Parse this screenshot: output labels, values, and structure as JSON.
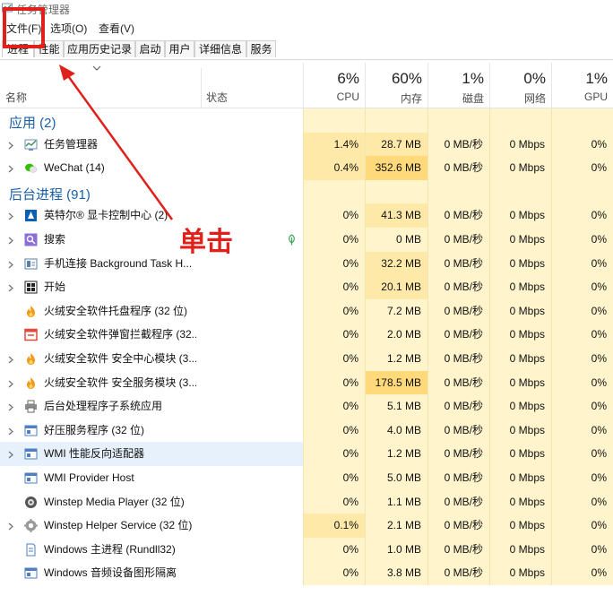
{
  "window": {
    "title": "任务管理器"
  },
  "menu": {
    "items": [
      "文件(F)",
      "选项(O)",
      "查看(V)"
    ]
  },
  "tabs": [
    "进程",
    "性能",
    "应用历史记录",
    "启动",
    "用户",
    "详细信息",
    "服务"
  ],
  "active_tab": 0,
  "header": {
    "name_label": "名称",
    "status_label": "状态",
    "columns": [
      {
        "pct": "6%",
        "label": "CPU"
      },
      {
        "pct": "60%",
        "label": "内存"
      },
      {
        "pct": "1%",
        "label": "磁盘"
      },
      {
        "pct": "0%",
        "label": "网络"
      },
      {
        "pct": "1%",
        "label": "GPU"
      }
    ]
  },
  "groups": {
    "apps": "应用 (2)",
    "background": "后台进程 (91)"
  },
  "apps": [
    {
      "name": "任务管理器",
      "icon": "task-manager-icon",
      "expandable": true,
      "cpu": "1.4%",
      "mem": "28.7 MB",
      "disk": "0 MB/秒",
      "net": "0 Mbps",
      "gpu": "0%"
    },
    {
      "name": "WeChat (14)",
      "icon": "wechat-icon",
      "expandable": true,
      "cpu": "0.4%",
      "mem": "352.6 MB",
      "disk": "0 MB/秒",
      "net": "0 Mbps",
      "gpu": "0%"
    }
  ],
  "background": [
    {
      "name": "英特尔® 显卡控制中心 (2)",
      "icon": "intel-graphics-icon",
      "expandable": true,
      "cpu": "0%",
      "mem": "41.3 MB",
      "disk": "0 MB/秒",
      "net": "0 Mbps",
      "gpu": "0%"
    },
    {
      "name": "搜索",
      "icon": "search-icon",
      "expandable": true,
      "status_icon": "leaf-icon",
      "cpu": "0%",
      "mem": "0 MB",
      "disk": "0 MB/秒",
      "net": "0 Mbps",
      "gpu": "0%"
    },
    {
      "name": "手机连接 Background Task H...",
      "icon": "phone-link-icon",
      "expandable": true,
      "cpu": "0%",
      "mem": "32.2 MB",
      "disk": "0 MB/秒",
      "net": "0 Mbps",
      "gpu": "0%"
    },
    {
      "name": "开始",
      "icon": "start-icon",
      "expandable": true,
      "cpu": "0%",
      "mem": "20.1 MB",
      "disk": "0 MB/秒",
      "net": "0 Mbps",
      "gpu": "0%"
    },
    {
      "name": "火绒安全软件托盘程序 (32 位)",
      "icon": "huorong-icon",
      "expandable": false,
      "cpu": "0%",
      "mem": "7.2 MB",
      "disk": "0 MB/秒",
      "net": "0 Mbps",
      "gpu": "0%"
    },
    {
      "name": "火绒安全软件弹窗拦截程序 (32...",
      "icon": "popup-block-icon",
      "expandable": false,
      "cpu": "0%",
      "mem": "2.0 MB",
      "disk": "0 MB/秒",
      "net": "0 Mbps",
      "gpu": "0%"
    },
    {
      "name": "火绒安全软件 安全中心模块 (3...",
      "icon": "huorong-icon",
      "expandable": true,
      "cpu": "0%",
      "mem": "1.2 MB",
      "disk": "0 MB/秒",
      "net": "0 Mbps",
      "gpu": "0%"
    },
    {
      "name": "火绒安全软件 安全服务模块 (3...",
      "icon": "huorong-icon",
      "expandable": true,
      "cpu": "0%",
      "mem": "178.5 MB",
      "disk": "0 MB/秒",
      "net": "0 Mbps",
      "gpu": "0%"
    },
    {
      "name": "后台处理程序子系统应用",
      "icon": "printer-icon",
      "expandable": true,
      "cpu": "0%",
      "mem": "5.1 MB",
      "disk": "0 MB/秒",
      "net": "0 Mbps",
      "gpu": "0%"
    },
    {
      "name": "好压服务程序 (32 位)",
      "icon": "app-window-icon",
      "expandable": true,
      "cpu": "0%",
      "mem": "4.0 MB",
      "disk": "0 MB/秒",
      "net": "0 Mbps",
      "gpu": "0%"
    },
    {
      "name": "WMI 性能反向适配器",
      "icon": "app-window-icon",
      "expandable": true,
      "selected": true,
      "cpu": "0%",
      "mem": "1.2 MB",
      "disk": "0 MB/秒",
      "net": "0 Mbps",
      "gpu": "0%"
    },
    {
      "name": "WMI Provider Host",
      "icon": "app-window-icon",
      "expandable": false,
      "cpu": "0%",
      "mem": "5.0 MB",
      "disk": "0 MB/秒",
      "net": "0 Mbps",
      "gpu": "0%"
    },
    {
      "name": "Winstep Media Player (32 位)",
      "icon": "winstep-icon",
      "expandable": false,
      "cpu": "0%",
      "mem": "1.1 MB",
      "disk": "0 MB/秒",
      "net": "0 Mbps",
      "gpu": "0%"
    },
    {
      "name": "Winstep Helper Service (32 位)",
      "icon": "winstep-gear-icon",
      "expandable": true,
      "cpu": "0.1%",
      "mem": "2.1 MB",
      "disk": "0 MB/秒",
      "net": "0 Mbps",
      "gpu": "0%"
    },
    {
      "name": "Windows 主进程 (Rundll32)",
      "icon": "document-icon",
      "expandable": false,
      "cpu": "0%",
      "mem": "1.0 MB",
      "disk": "0 MB/秒",
      "net": "0 Mbps",
      "gpu": "0%"
    },
    {
      "name": "Windows 音频设备图形隔离",
      "icon": "app-window-icon",
      "expandable": false,
      "cpu": "0%",
      "mem": "3.8 MB",
      "disk": "0 MB/秒",
      "net": "0 Mbps",
      "gpu": "0%"
    }
  ],
  "annotation": {
    "text": "单击",
    "color": "#e0201a"
  },
  "colors": {
    "heat_light": "#fff4cc",
    "heat_mid": "#ffe9a8",
    "heat_strong": "#ffd97a",
    "group_label": "#1a5fa8",
    "selected": "#e6f1fb"
  }
}
